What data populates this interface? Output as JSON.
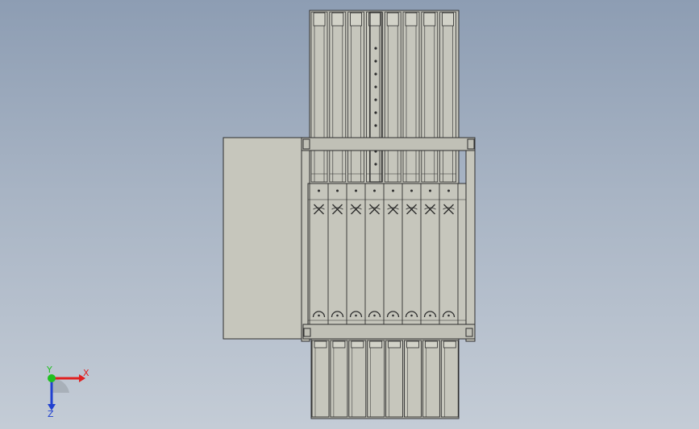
{
  "viewport": {
    "background_top": "#8d9db3",
    "background_bottom": "#c4ccd6",
    "model_fill": "#c6c6bc",
    "model_fill_dark": "#b8b8ae",
    "edge_color": "#2e2e2e"
  },
  "triad": {
    "x_label": "X",
    "y_label": "Y",
    "z_label": "Z",
    "x_color": "#e02020",
    "y_color": "#20c020",
    "z_color": "#2040d0"
  },
  "model": {
    "upper_slots": 8,
    "middle_slots": 8,
    "lower_slots": 8
  }
}
